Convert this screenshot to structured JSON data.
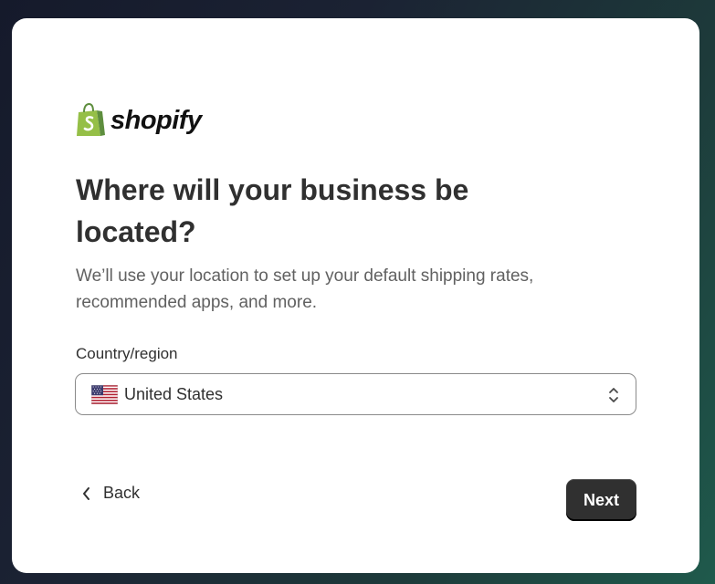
{
  "brand": {
    "name": "shopify",
    "logo_icon": "shopify-bag-icon",
    "logo_color": "#5e8e3e"
  },
  "step": {
    "title": "Where will your business be located?",
    "subtitle": "We’ll use your location to set up your default shipping rates, recommended apps, and more."
  },
  "country_field": {
    "label": "Country/region",
    "selected_value": "United States",
    "flag_icon": "us-flag-icon",
    "chevron_icon": "select-chevrons-icon"
  },
  "navigation": {
    "back_label": "Back",
    "back_icon": "chevron-left-icon",
    "next_label": "Next",
    "next_color": "#303030"
  }
}
